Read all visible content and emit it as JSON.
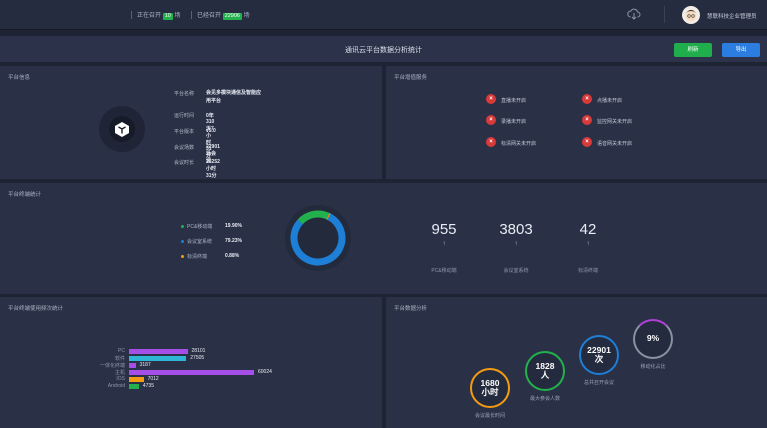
{
  "topbar": {
    "ongoing_label": "正在召开",
    "ongoing_count": "10",
    "ongoing_unit": "场",
    "done_label": "已经召开",
    "done_count": "22906",
    "done_unit": "场",
    "user_name": "慧联科技企业管理员"
  },
  "header": {
    "title": "通讯云平台数据分析统计",
    "refresh_label": "刷新",
    "export_label": "导出"
  },
  "overview": {
    "title": "平台信息",
    "rows": [
      {
        "key": "平台名称",
        "value": "会见多模块通信及智能应用平台"
      },
      {
        "key": "运行时间",
        "value": "0年310天7小时31分"
      },
      {
        "key": "平台版本",
        "value": "v5.0"
      },
      {
        "key": "会议场数",
        "value": "22901场会议"
      },
      {
        "key": "会议时长",
        "value": "23252小时31分"
      }
    ]
  },
  "services": {
    "title": "平台增值服务",
    "items": [
      {
        "label": "直播未开启"
      },
      {
        "label": "点播未开启"
      },
      {
        "label": "录播未开启"
      },
      {
        "label": "监控网关未开启"
      },
      {
        "label": "标清网关未开启"
      },
      {
        "label": "语音网关未开启"
      }
    ]
  },
  "terminal": {
    "title": "平台终端统计",
    "legend": [
      {
        "label": "PC&移动端",
        "pct": "19.90%",
        "color": "#22b14c"
      },
      {
        "label": "会议室系统",
        "pct": "79.23%",
        "color": "#1e7fd6"
      },
      {
        "label": "标清终端",
        "pct": "0.88%",
        "color": "#f39c12"
      }
    ],
    "stats": [
      {
        "value": "955",
        "arrow": "↑",
        "label": "PC&移动端"
      },
      {
        "value": "3803",
        "arrow": "↑",
        "label": "会议室系统"
      },
      {
        "value": "42",
        "arrow": "↑",
        "label": "标清终端"
      }
    ]
  },
  "chart_data": {
    "type": "bar",
    "title": "平台终端使用频次统计",
    "categories": [
      "PC",
      "软件",
      "一体化终端",
      "主机",
      "IOS",
      "Android"
    ],
    "values": [
      28101,
      27505,
      3187,
      60024,
      7012,
      4735
    ],
    "colors": [
      "#a64ee8",
      "#2eb6d6",
      "#a64ee8",
      "#a64ee8",
      "#f39c12",
      "#22b14c"
    ],
    "xlim": [
      0,
      60024
    ]
  },
  "analysis": {
    "title": "平台数据分析",
    "circles": [
      {
        "value": "1680\n小时",
        "label": "会议最长时间",
        "color": "#f39c12"
      },
      {
        "value": "1828\n人",
        "label": "最大参会人数",
        "color": "#22b14c"
      },
      {
        "value": "22901\n次",
        "label": "总共召开会议",
        "color": "#1e7fd6"
      },
      {
        "value": "9%",
        "label": "移动化占比",
        "color": "#b23fd8",
        "progress": 0.09
      }
    ]
  }
}
